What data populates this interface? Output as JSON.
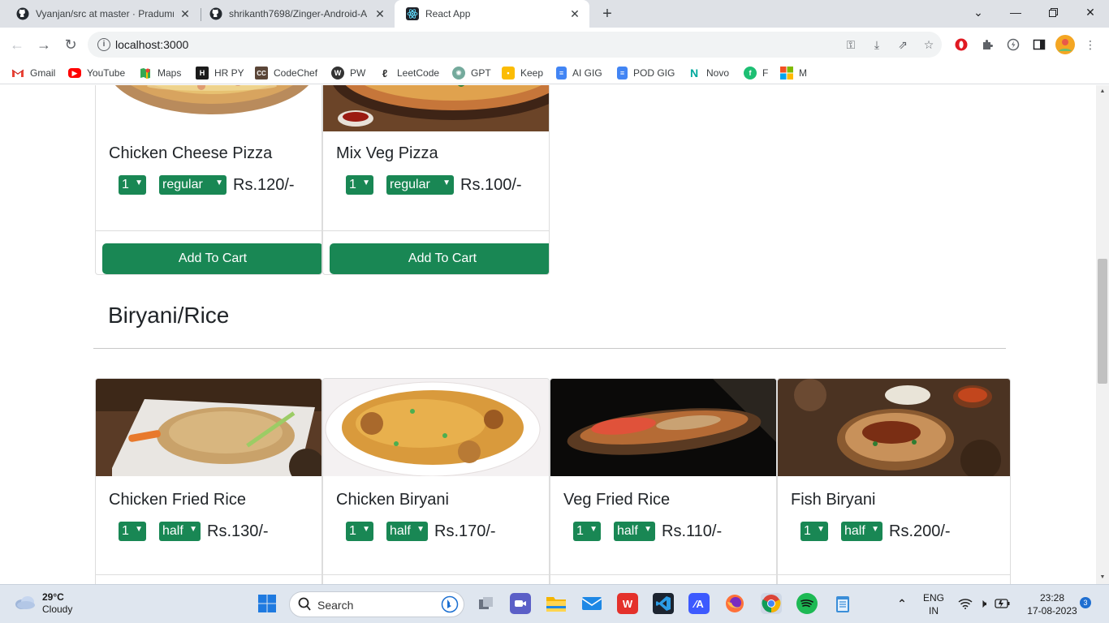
{
  "browser": {
    "tabs": [
      {
        "title": "Vyanjan/src at master · Pradumn",
        "icon": "github-icon"
      },
      {
        "title": "shrikanth7698/Zinger-Android-A",
        "icon": "github-icon"
      },
      {
        "title": "React App",
        "icon": "react-icon",
        "active": true
      }
    ],
    "url": "localhost:3000",
    "bookmarks": [
      {
        "label": "Gmail",
        "icon": "gmail-icon",
        "color": "#ea4335"
      },
      {
        "label": "YouTube",
        "icon": "youtube-icon",
        "color": "#ff0000"
      },
      {
        "label": "Maps",
        "icon": "maps-icon",
        "color": "#34a853"
      },
      {
        "label": "HR PY",
        "icon": "hackerrank-icon",
        "color": "#1b1b1b"
      },
      {
        "label": "CodeChef",
        "icon": "codechef-icon",
        "color": "#5b4638"
      },
      {
        "label": "PW",
        "icon": "wordpress-icon",
        "color": "#333333"
      },
      {
        "label": "LeetCode",
        "icon": "leetcode-icon",
        "color": "#ffa116"
      },
      {
        "label": "GPT",
        "icon": "chatgpt-icon",
        "color": "#74aa9c"
      },
      {
        "label": "Keep",
        "icon": "keep-icon",
        "color": "#fbbc04"
      },
      {
        "label": "AI GIG",
        "icon": "docs-icon",
        "color": "#4285f4"
      },
      {
        "label": "POD GIG",
        "icon": "docs-icon",
        "color": "#4285f4"
      },
      {
        "label": "Novo",
        "icon": "novo-icon",
        "color": "#00a99d"
      },
      {
        "label": "F",
        "icon": "fiverr-icon",
        "color": "#1dbf73"
      },
      {
        "label": "M",
        "icon": "microsoft-icon",
        "color": "#f25022"
      }
    ]
  },
  "menu": {
    "pizza_items": [
      {
        "name": "Chicken Cheese Pizza",
        "qty": "1",
        "size": "regular",
        "price": "Rs.120/-",
        "button": "Add To Cart"
      },
      {
        "name": "Mix Veg Pizza",
        "qty": "1",
        "size": "regular",
        "price": "Rs.100/-",
        "button": "Add To Cart"
      }
    ],
    "section_title": "Biryani/Rice",
    "rice_items": [
      {
        "name": "Chicken Fried Rice",
        "qty": "1",
        "size": "half",
        "price": "Rs.130/-"
      },
      {
        "name": "Chicken Biryani",
        "qty": "1",
        "size": "half",
        "price": "Rs.170/-"
      },
      {
        "name": "Veg Fried Rice",
        "qty": "1",
        "size": "half",
        "price": "Rs.110/-"
      },
      {
        "name": "Fish Biryani",
        "qty": "1",
        "size": "half",
        "price": "Rs.200/-"
      }
    ]
  },
  "taskbar": {
    "weather_temp": "29°C",
    "weather_desc": "Cloudy",
    "search_label": "Search",
    "language": "ENG",
    "region": "IN",
    "time": "23:28",
    "date": "17-08-2023",
    "notification_count": "3"
  },
  "colors": {
    "accent_green": "#198754"
  }
}
